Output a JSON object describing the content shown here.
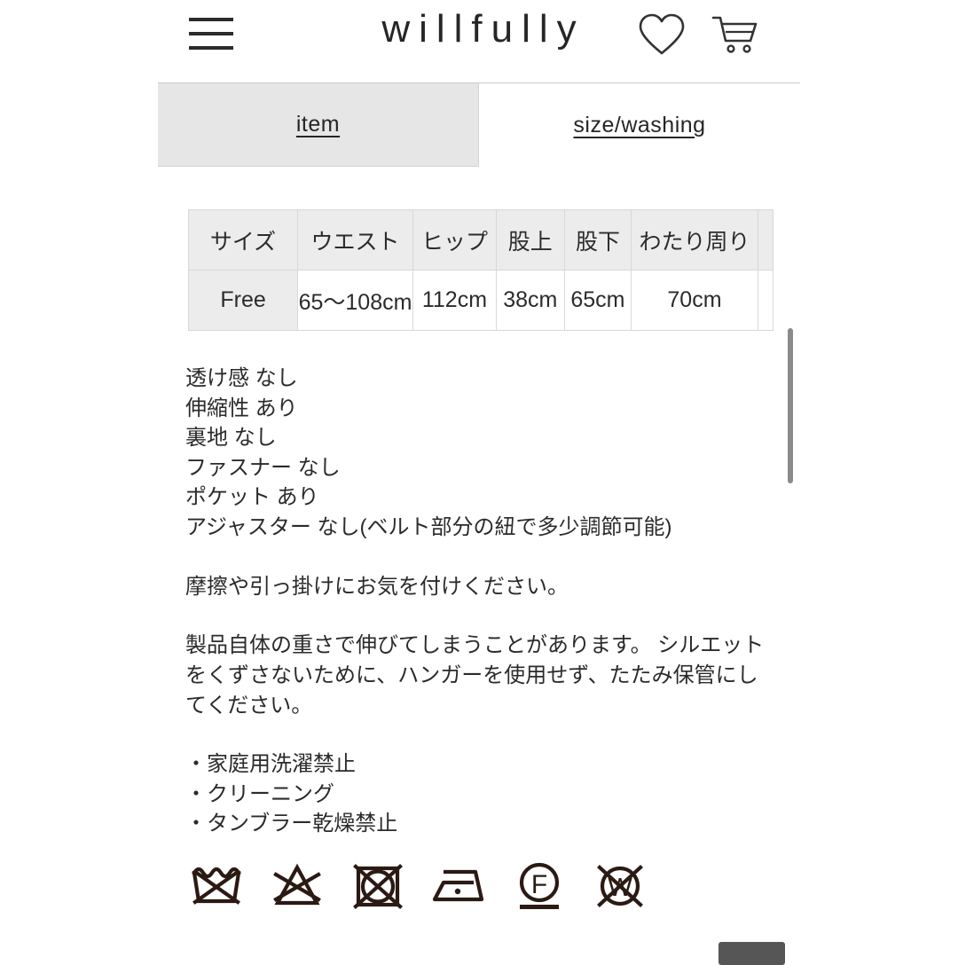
{
  "header": {
    "menu_icon": "hamburger-menu-icon",
    "brand": "willfully",
    "wishlist_icon": "heart-icon",
    "cart_icon": "shopping-cart-icon"
  },
  "tabs": [
    {
      "id": "item",
      "label": "item",
      "selected": true
    },
    {
      "id": "size-washing",
      "label": "size/washing",
      "selected": false
    }
  ],
  "size_table": {
    "headers": [
      "サイズ",
      "ウエスト",
      "ヒップ",
      "股上",
      "股下",
      "わたり周り",
      ""
    ],
    "rows": [
      [
        "Free",
        "65〜108cm",
        "112cm",
        "38cm",
        "65cm",
        "70cm",
        ""
      ]
    ]
  },
  "spec_list": [
    "透け感 なし",
    "伸縮性 あり",
    "裏地 なし",
    "ファスナー なし",
    "ポケット あり",
    "アジャスター なし(ベルト部分の紐で多少調節可能)"
  ],
  "notes": {
    "friction": "摩擦や引っ掛けにお気を付けください。",
    "storage": "製品自体の重さで伸びてしまうことがあります。\nシルエットをくずさないために、ハンガーを使用せず、たたみ保管にしてください。"
  },
  "care_bullets": [
    "・家庭用洗濯禁止",
    "・クリーニング",
    "・タンブラー乾燥禁止"
  ],
  "care_symbols": [
    {
      "id": "do-not-wash-icon",
      "title": "家庭用洗濯禁止"
    },
    {
      "id": "do-not-bleach-icon",
      "title": "塩素系・酸素系漂白剤使用禁止"
    },
    {
      "id": "do-not-tumble-dry-icon",
      "title": "タンブラー乾燥禁止"
    },
    {
      "id": "iron-low-heat-icon",
      "title": "低温アイロン可"
    },
    {
      "id": "dry-clean-petroleum-mild-icon",
      "title": "石油系ドライクリーニング弱"
    },
    {
      "id": "do-not-wet-clean-icon",
      "title": "ウエットクリーニング禁止"
    }
  ],
  "colors": {
    "text": "#2b2b2b",
    "tab_selected_bg": "#e6e6e6",
    "table_header_bg": "#ececec",
    "border": "#d8d8d8",
    "scrollbar": "#8a8a8a",
    "pill": "#565656"
  }
}
